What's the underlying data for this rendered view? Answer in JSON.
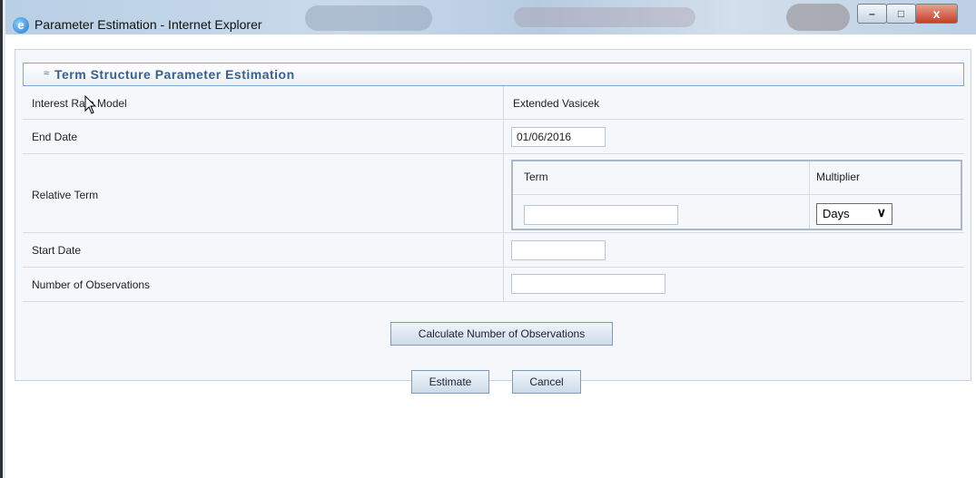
{
  "window": {
    "title": "Parameter Estimation - Internet Explorer",
    "icon": "ie-icon",
    "controls": {
      "minimize": "–",
      "maximize": "□",
      "close": "x"
    }
  },
  "section": {
    "toggle_icon": "double-chevron-up-icon",
    "toggle_glyph": "≈",
    "title": "Term Structure Parameter Estimation"
  },
  "form": {
    "interest_rate_model": {
      "label": "Interest Rate Model",
      "value": "Extended Vasicek"
    },
    "end_date": {
      "label": "End Date",
      "value": "01/06/2016"
    },
    "relative_term": {
      "label": "Relative Term",
      "term_header": "Term",
      "multiplier_header": "Multiplier",
      "term_value": "",
      "multiplier_value": "Days"
    },
    "start_date": {
      "label": "Start Date",
      "value": ""
    },
    "number_of_observations": {
      "label": "Number of Observations",
      "value": ""
    }
  },
  "buttons": {
    "calculate": "Calculate Number of Observations",
    "estimate": "Estimate",
    "cancel": "Cancel"
  },
  "colors": {
    "accent": "#3b5f8a",
    "border": "#7fa6cf",
    "panel": "#f5f7fa"
  }
}
